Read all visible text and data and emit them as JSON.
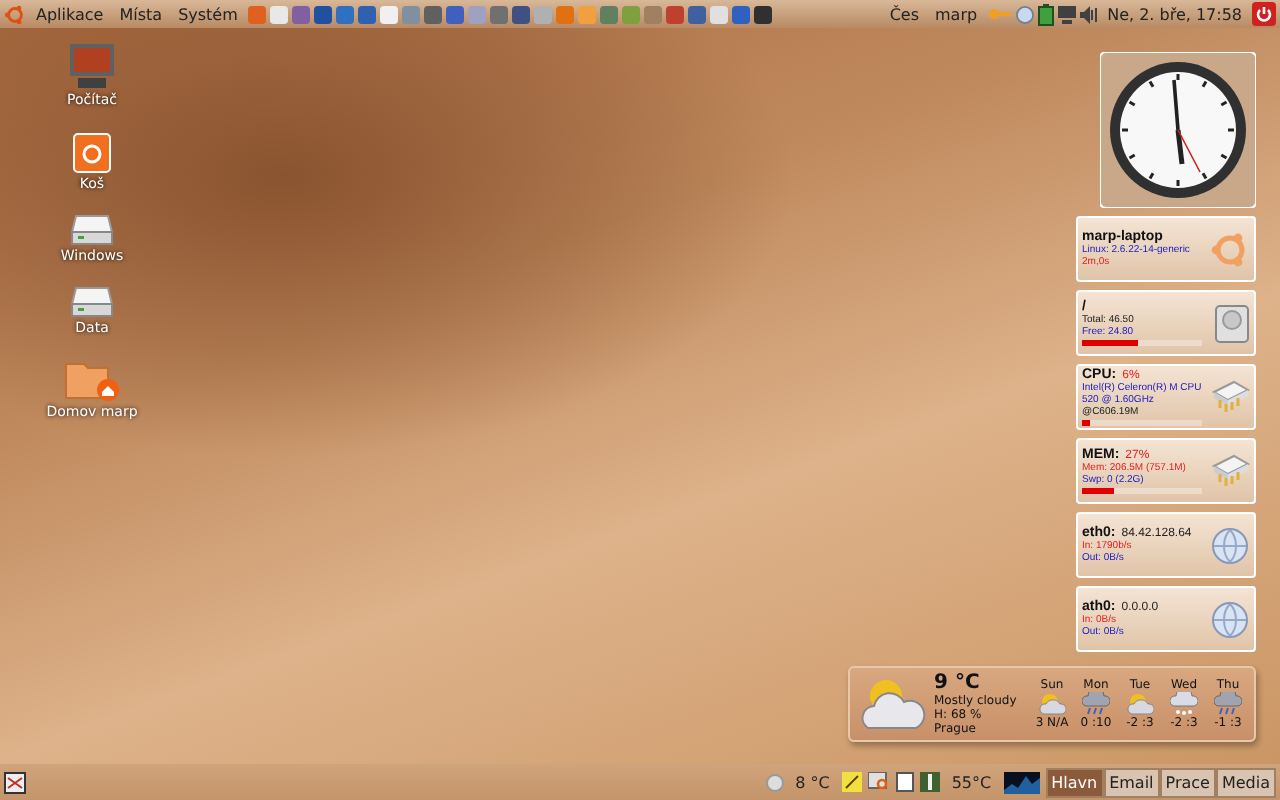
{
  "top_panel": {
    "menus": [
      "Aplikace",
      "Místa",
      "Systém"
    ],
    "keyboard": "Čes",
    "user": "marp",
    "clock": "Ne,  2. bře, 17:58"
  },
  "desktop_icons": [
    {
      "label": "Počítač",
      "kind": "computer"
    },
    {
      "label": "Koš",
      "kind": "trash"
    },
    {
      "label": "Windows",
      "kind": "drive"
    },
    {
      "label": "Data",
      "kind": "drive"
    },
    {
      "label": "Domov marp",
      "kind": "home"
    }
  ],
  "monitors": [
    {
      "kind": "host",
      "title": "marp-laptop",
      "lines": [
        {
          "text": "Linux: 2.6.22-14-generic",
          "kind": "info"
        },
        {
          "text": "2m,0s",
          "kind": "alert"
        }
      ]
    },
    {
      "kind": "disk",
      "title": "/",
      "level": 0.47,
      "lines": [
        {
          "text": "Total: 46.50",
          "kind": "plain"
        },
        {
          "text": "Free: 24.80",
          "kind": "info"
        }
      ]
    },
    {
      "kind": "chip",
      "title": "CPU:",
      "value": "6%",
      "level": 0.06,
      "lines": [
        {
          "text": "Intel(R) Celeron(R) M CPU",
          "kind": "info"
        },
        {
          "text": "520  @ 1.60GHz",
          "kind": "info"
        },
        {
          "text": "@C606.19M",
          "kind": "plain"
        }
      ]
    },
    {
      "kind": "chip",
      "title": "MEM:",
      "value": "27%",
      "level": 0.27,
      "lines": [
        {
          "text": "Mem: 206.5M (757.1M)",
          "kind": "alert"
        },
        {
          "text": "Swp: 0 (2.2G)",
          "kind": "info"
        }
      ]
    },
    {
      "kind": "net",
      "title": "eth0:",
      "value": "84.42.128.64",
      "lines": [
        {
          "text": "In:  1790b/s",
          "kind": "alert"
        },
        {
          "text": "Out:  0B/s",
          "kind": "info"
        }
      ]
    },
    {
      "kind": "net",
      "title": "ath0:",
      "value": "0.0.0.0",
      "lines": [
        {
          "text": "In:  0B/s",
          "kind": "alert"
        },
        {
          "text": "Out:  0B/s",
          "kind": "info"
        }
      ]
    }
  ],
  "weather": {
    "temperature": "9 °C",
    "condition": "Mostly cloudy",
    "humidity": "H: 68 %",
    "city": "Prague",
    "forecast": [
      {
        "day": "Sun",
        "temps": "3 N/A",
        "kind": "sun-cloud"
      },
      {
        "day": "Mon",
        "temps": "0 :10",
        "kind": "rain"
      },
      {
        "day": "Tue",
        "temps": "-2 :3",
        "kind": "sun-cloud"
      },
      {
        "day": "Wed",
        "temps": "-2 :3",
        "kind": "snow"
      },
      {
        "day": "Thu",
        "temps": "-1 :3",
        "kind": "rain"
      }
    ]
  },
  "bottom_panel": {
    "outdoor_temp": "8 °C",
    "cpu_temp": "55°C",
    "workspaces": [
      {
        "label": "Hlavn",
        "selected": true
      },
      {
        "label": "Email",
        "selected": false
      },
      {
        "label": "Prace",
        "selected": false
      },
      {
        "label": "Media",
        "selected": false
      }
    ]
  }
}
